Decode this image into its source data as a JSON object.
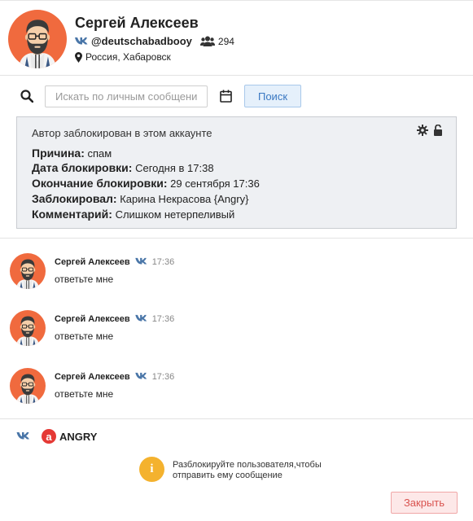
{
  "profile": {
    "name": "Сергей Алексеев",
    "handle": "@deutschabadbooy",
    "friends_count": "294",
    "location": "Россия, Хабаровск",
    "vk_label": "vk"
  },
  "search": {
    "placeholder": "Искать по личным сообщениям",
    "button_label": "Поиск"
  },
  "block_info": {
    "title": "Автор заблокирован в этом аккаунте",
    "reason_label": "Причина:",
    "reason_value": "спам",
    "date_label": "Дата блокировки:",
    "date_value": "Сегодня в 17:38",
    "end_label": "Окончание блокировки:",
    "end_value": "29 сентября 17:36",
    "blocked_by_label": "Заблокировал:",
    "blocked_by_value": "Карина Некрасова {Angry}",
    "comment_label": "Комментарий:",
    "comment_value": "Слишком нетерпеливый"
  },
  "messages": [
    {
      "author": "Сергей Алексеев",
      "time": "17:36",
      "text": "ответьте мне"
    },
    {
      "author": "Сергей Алексеев",
      "time": "17:36",
      "text": "ответьте мне"
    },
    {
      "author": "Сергей Алексеев",
      "time": "17:36",
      "text": "ответьте мне"
    }
  ],
  "footer": {
    "source_label": "ANGRY",
    "angry_logo_letter": "a",
    "info_text": "Разблокируйте пользователя,чтобы отправить ему сообщение",
    "info_icon_glyph": "i",
    "close_label": "Закрыть"
  },
  "colors": {
    "vk_blue": "#4a76a8",
    "avatar_bg": "#f06a3e",
    "panel_bg": "#eef0f3",
    "search_btn_bg": "#e5f0fb",
    "close_btn_bg": "#fde8e8",
    "info_icon_bg": "#f4b22e",
    "angry_red": "#e53935"
  }
}
